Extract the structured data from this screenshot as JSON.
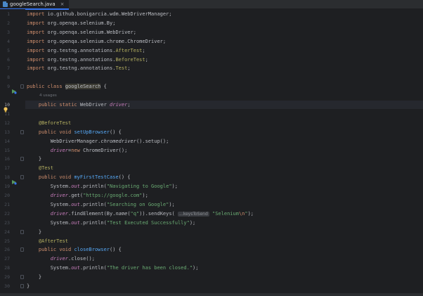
{
  "tab": {
    "label": "googleSearch.java",
    "close_glyph": "×",
    "icon": "java-file-icon"
  },
  "editor": {
    "current_line": 10,
    "usages_hint": "4 usages",
    "lines": [
      {
        "num": "1",
        "code": [
          [
            "kw",
            "import "
          ],
          [
            "",
            "io.github.bonigarcia.wdm.WebDriverManager;"
          ]
        ]
      },
      {
        "num": "2",
        "code": [
          [
            "kw",
            "import "
          ],
          [
            "",
            "org.openqa.selenium.By;"
          ]
        ]
      },
      {
        "num": "3",
        "code": [
          [
            "kw",
            "import "
          ],
          [
            "",
            "org.openqa.selenium.WebDriver;"
          ]
        ]
      },
      {
        "num": "4",
        "code": [
          [
            "kw",
            "import "
          ],
          [
            "",
            "org.openqa.selenium.chrome.ChromeDriver;"
          ]
        ]
      },
      {
        "num": "5",
        "code": [
          [
            "kw",
            "import "
          ],
          [
            "",
            "org.testng.annotations."
          ],
          [
            "ann",
            "AfterTest"
          ],
          [
            "",
            ";"
          ]
        ]
      },
      {
        "num": "6",
        "code": [
          [
            "kw",
            "import "
          ],
          [
            "",
            "org.testng.annotations."
          ],
          [
            "ann",
            "BeforeTest"
          ],
          [
            "",
            ";"
          ]
        ]
      },
      {
        "num": "7",
        "code": [
          [
            "kw",
            "import "
          ],
          [
            "",
            "org.testng.annotations."
          ],
          [
            "ann",
            "Test"
          ],
          [
            "",
            ";"
          ]
        ]
      },
      {
        "num": "8",
        "code": []
      },
      {
        "num": "9",
        "code": [
          [
            "kw",
            "public class "
          ],
          [
            "cls-hl",
            "googleSearch"
          ],
          [
            "",
            " {"
          ]
        ]
      },
      {
        "num": "10",
        "code": [
          [
            "",
            "    "
          ],
          [
            "kw",
            "public static "
          ],
          [
            "",
            "WebDriver "
          ],
          [
            "fld",
            "driver"
          ],
          [
            "",
            ";"
          ]
        ]
      },
      {
        "num": "11",
        "code": []
      },
      {
        "num": "12",
        "code": [
          [
            "",
            "    "
          ],
          [
            "ann",
            "@BeforeTest"
          ]
        ]
      },
      {
        "num": "13",
        "code": [
          [
            "",
            "    "
          ],
          [
            "kw",
            "public void "
          ],
          [
            "fn",
            "setUpBrowser"
          ],
          [
            "",
            "() {"
          ]
        ]
      },
      {
        "num": "14",
        "code": [
          [
            "",
            "        WebDriverManager."
          ],
          [
            "st-method",
            "chromedriver"
          ],
          [
            "",
            "().setup();"
          ]
        ]
      },
      {
        "num": "15",
        "code": [
          [
            "",
            "        "
          ],
          [
            "fld",
            "driver"
          ],
          [
            "",
            "="
          ],
          [
            "kw",
            "new "
          ],
          [
            "",
            "ChromeDriver();"
          ]
        ]
      },
      {
        "num": "16",
        "code": [
          [
            "",
            "    }"
          ]
        ]
      },
      {
        "num": "17",
        "code": [
          [
            "",
            "    "
          ],
          [
            "ann",
            "@Test"
          ]
        ]
      },
      {
        "num": "18",
        "code": [
          [
            "",
            "    "
          ],
          [
            "kw",
            "public void "
          ],
          [
            "fn",
            "myFirstTestCase"
          ],
          [
            "",
            "() {"
          ]
        ]
      },
      {
        "num": "19",
        "code": [
          [
            "",
            "        System."
          ],
          [
            "stat",
            "out"
          ],
          [
            "",
            ".println("
          ],
          [
            "str",
            "\"Navigating to Google\""
          ],
          [
            "",
            ");"
          ]
        ]
      },
      {
        "num": "20",
        "code": [
          [
            "",
            "        "
          ],
          [
            "fld",
            "driver"
          ],
          [
            "",
            ".get("
          ],
          [
            "str",
            "\"https://google.com\""
          ],
          [
            "",
            ");"
          ]
        ]
      },
      {
        "num": "21",
        "code": [
          [
            "",
            "        System."
          ],
          [
            "stat",
            "out"
          ],
          [
            "",
            ".println("
          ],
          [
            "str",
            "\"Searching on Google\""
          ],
          [
            "",
            ");"
          ]
        ]
      },
      {
        "num": "22",
        "code": [
          [
            "",
            "        "
          ],
          [
            "fld",
            "driver"
          ],
          [
            "",
            ".findElement(By."
          ],
          [
            "st-method",
            "name"
          ],
          [
            "",
            "("
          ],
          [
            "str",
            "\"q\""
          ],
          [
            "",
            "))."
          ],
          [
            "",
            "sendKeys( "
          ],
          [
            "param-hint",
            "...keysToSend"
          ],
          [
            "",
            " "
          ],
          [
            "str",
            "\"Selenium"
          ],
          [
            "esc",
            "\\n"
          ],
          [
            "str",
            "\""
          ],
          [
            "",
            ");"
          ]
        ]
      },
      {
        "num": "23",
        "code": [
          [
            "",
            "        System."
          ],
          [
            "stat",
            "out"
          ],
          [
            "",
            ".println("
          ],
          [
            "str",
            "\"Test Executed Successfully\""
          ],
          [
            "",
            ");"
          ]
        ]
      },
      {
        "num": "24",
        "code": [
          [
            "",
            "    }"
          ]
        ]
      },
      {
        "num": "25",
        "code": [
          [
            "",
            "    "
          ],
          [
            "ann",
            "@AfterTest"
          ]
        ]
      },
      {
        "num": "26",
        "code": [
          [
            "",
            "    "
          ],
          [
            "kw",
            "public void "
          ],
          [
            "fn",
            "closeBrowser"
          ],
          [
            "",
            "() {"
          ]
        ]
      },
      {
        "num": "27",
        "code": [
          [
            "",
            "        "
          ],
          [
            "fld",
            "driver"
          ],
          [
            "",
            ".close();"
          ]
        ]
      },
      {
        "num": "28",
        "code": [
          [
            "",
            "        System."
          ],
          [
            "stat",
            "out"
          ],
          [
            "",
            ".println("
          ],
          [
            "str",
            "\"The driver has been closed.\""
          ],
          [
            "",
            ");"
          ]
        ]
      },
      {
        "num": "29",
        "code": [
          [
            "",
            "    }"
          ]
        ]
      },
      {
        "num": "30",
        "code": [
          [
            "",
            "}"
          ]
        ]
      }
    ]
  },
  "colors": {
    "background": "#1e1f22",
    "keyword": "#cf8e6d",
    "annotation": "#b3ae60",
    "method": "#56a8f5",
    "field": "#c77dbb",
    "string": "#6aab73"
  },
  "icons": {
    "run_gutter": "run-icon",
    "intention": "lightbulb-icon",
    "fold": "fold-icon"
  }
}
